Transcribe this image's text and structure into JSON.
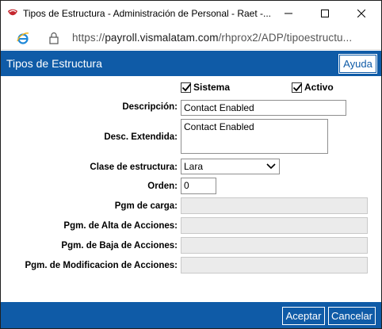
{
  "window": {
    "title": "Tipos de Estructura - Administración de Personal - Raet -...",
    "url_prefix": "https://",
    "url_domain": "payroll.vismalatam.com",
    "url_path": "/rhprox2/ADP/tipoestructu..."
  },
  "header": {
    "title": "Tipos de Estructura",
    "help_label": "Ayuda"
  },
  "form": {
    "sistema": {
      "label": "Sistema",
      "checked": true
    },
    "activo": {
      "label": "Activo",
      "checked": true
    },
    "descripcion": {
      "label": "Descripción:",
      "value": "Contact Enabled"
    },
    "desc_extendida": {
      "label": "Desc. Extendida:",
      "value": "Contact Enabled"
    },
    "clase_estructura": {
      "label": "Clase de estructura:",
      "value": "Lara"
    },
    "orden": {
      "label": "Orden:",
      "value": "0"
    },
    "pgm_carga": {
      "label": "Pgm de carga:",
      "value": ""
    },
    "pgm_alta": {
      "label": "Pgm. de Alta de Acciones:",
      "value": ""
    },
    "pgm_baja": {
      "label": "Pgm. de Baja de Acciones:",
      "value": ""
    },
    "pgm_modif": {
      "label": "Pgm. de Modificacion de Acciones:",
      "value": ""
    }
  },
  "footer": {
    "accept_label": "Aceptar",
    "cancel_label": "Cancelar"
  },
  "colors": {
    "header_blue": "#0f5ba7",
    "close_red": "#c4262e",
    "ie_blue": "#1e88d8"
  },
  "icons": [
    "app-logo-icon",
    "minimize-icon",
    "maximize-icon",
    "close-icon",
    "ie-browser-icon",
    "lock-icon",
    "checkmark-icon",
    "chevron-down-icon"
  ]
}
